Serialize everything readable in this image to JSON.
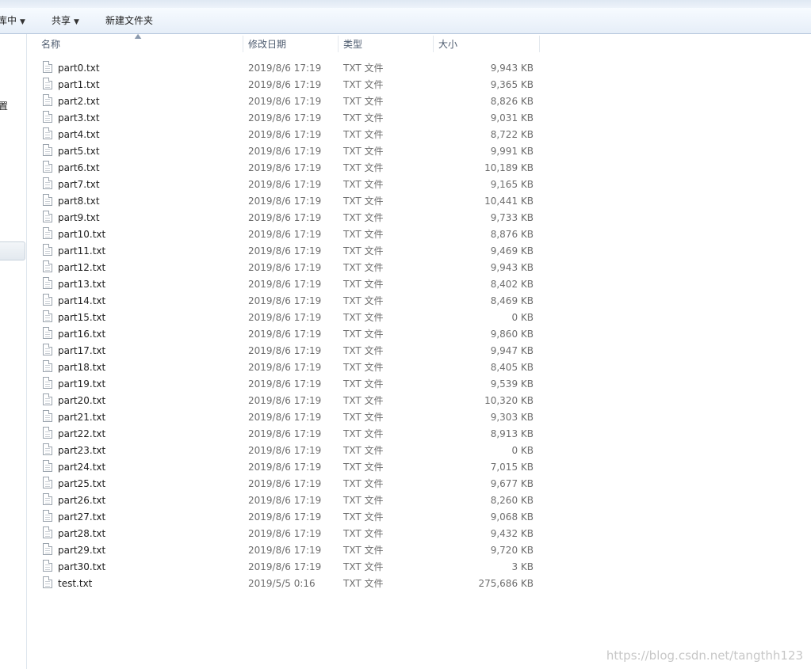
{
  "toolbar": {
    "include_in_library": "库中",
    "share": "共享",
    "new_folder": "新建文件夹"
  },
  "nav": {
    "partial_label": "置"
  },
  "columns": {
    "name": "名称",
    "date": "修改日期",
    "type": "类型",
    "size": "大小"
  },
  "files": [
    {
      "name": "part0.txt",
      "date": "2019/8/6 17:19",
      "type": "TXT 文件",
      "size": "9,943 KB"
    },
    {
      "name": "part1.txt",
      "date": "2019/8/6 17:19",
      "type": "TXT 文件",
      "size": "9,365 KB"
    },
    {
      "name": "part2.txt",
      "date": "2019/8/6 17:19",
      "type": "TXT 文件",
      "size": "8,826 KB"
    },
    {
      "name": "part3.txt",
      "date": "2019/8/6 17:19",
      "type": "TXT 文件",
      "size": "9,031 KB"
    },
    {
      "name": "part4.txt",
      "date": "2019/8/6 17:19",
      "type": "TXT 文件",
      "size": "8,722 KB"
    },
    {
      "name": "part5.txt",
      "date": "2019/8/6 17:19",
      "type": "TXT 文件",
      "size": "9,991 KB"
    },
    {
      "name": "part6.txt",
      "date": "2019/8/6 17:19",
      "type": "TXT 文件",
      "size": "10,189 KB"
    },
    {
      "name": "part7.txt",
      "date": "2019/8/6 17:19",
      "type": "TXT 文件",
      "size": "9,165 KB"
    },
    {
      "name": "part8.txt",
      "date": "2019/8/6 17:19",
      "type": "TXT 文件",
      "size": "10,441 KB"
    },
    {
      "name": "part9.txt",
      "date": "2019/8/6 17:19",
      "type": "TXT 文件",
      "size": "9,733 KB"
    },
    {
      "name": "part10.txt",
      "date": "2019/8/6 17:19",
      "type": "TXT 文件",
      "size": "8,876 KB"
    },
    {
      "name": "part11.txt",
      "date": "2019/8/6 17:19",
      "type": "TXT 文件",
      "size": "9,469 KB"
    },
    {
      "name": "part12.txt",
      "date": "2019/8/6 17:19",
      "type": "TXT 文件",
      "size": "9,943 KB"
    },
    {
      "name": "part13.txt",
      "date": "2019/8/6 17:19",
      "type": "TXT 文件",
      "size": "8,402 KB"
    },
    {
      "name": "part14.txt",
      "date": "2019/8/6 17:19",
      "type": "TXT 文件",
      "size": "8,469 KB"
    },
    {
      "name": "part15.txt",
      "date": "2019/8/6 17:19",
      "type": "TXT 文件",
      "size": "0 KB"
    },
    {
      "name": "part16.txt",
      "date": "2019/8/6 17:19",
      "type": "TXT 文件",
      "size": "9,860 KB"
    },
    {
      "name": "part17.txt",
      "date": "2019/8/6 17:19",
      "type": "TXT 文件",
      "size": "9,947 KB"
    },
    {
      "name": "part18.txt",
      "date": "2019/8/6 17:19",
      "type": "TXT 文件",
      "size": "8,405 KB"
    },
    {
      "name": "part19.txt",
      "date": "2019/8/6 17:19",
      "type": "TXT 文件",
      "size": "9,539 KB"
    },
    {
      "name": "part20.txt",
      "date": "2019/8/6 17:19",
      "type": "TXT 文件",
      "size": "10,320 KB"
    },
    {
      "name": "part21.txt",
      "date": "2019/8/6 17:19",
      "type": "TXT 文件",
      "size": "9,303 KB"
    },
    {
      "name": "part22.txt",
      "date": "2019/8/6 17:19",
      "type": "TXT 文件",
      "size": "8,913 KB"
    },
    {
      "name": "part23.txt",
      "date": "2019/8/6 17:19",
      "type": "TXT 文件",
      "size": "0 KB"
    },
    {
      "name": "part24.txt",
      "date": "2019/8/6 17:19",
      "type": "TXT 文件",
      "size": "7,015 KB"
    },
    {
      "name": "part25.txt",
      "date": "2019/8/6 17:19",
      "type": "TXT 文件",
      "size": "9,677 KB"
    },
    {
      "name": "part26.txt",
      "date": "2019/8/6 17:19",
      "type": "TXT 文件",
      "size": "8,260 KB"
    },
    {
      "name": "part27.txt",
      "date": "2019/8/6 17:19",
      "type": "TXT 文件",
      "size": "9,068 KB"
    },
    {
      "name": "part28.txt",
      "date": "2019/8/6 17:19",
      "type": "TXT 文件",
      "size": "9,432 KB"
    },
    {
      "name": "part29.txt",
      "date": "2019/8/6 17:19",
      "type": "TXT 文件",
      "size": "9,720 KB"
    },
    {
      "name": "part30.txt",
      "date": "2019/8/6 17:19",
      "type": "TXT 文件",
      "size": "3 KB"
    },
    {
      "name": "test.txt",
      "date": "2019/5/5 0:16",
      "type": "TXT 文件",
      "size": "275,686 KB"
    }
  ],
  "watermark": "https://blog.csdn.net/tangthh123"
}
